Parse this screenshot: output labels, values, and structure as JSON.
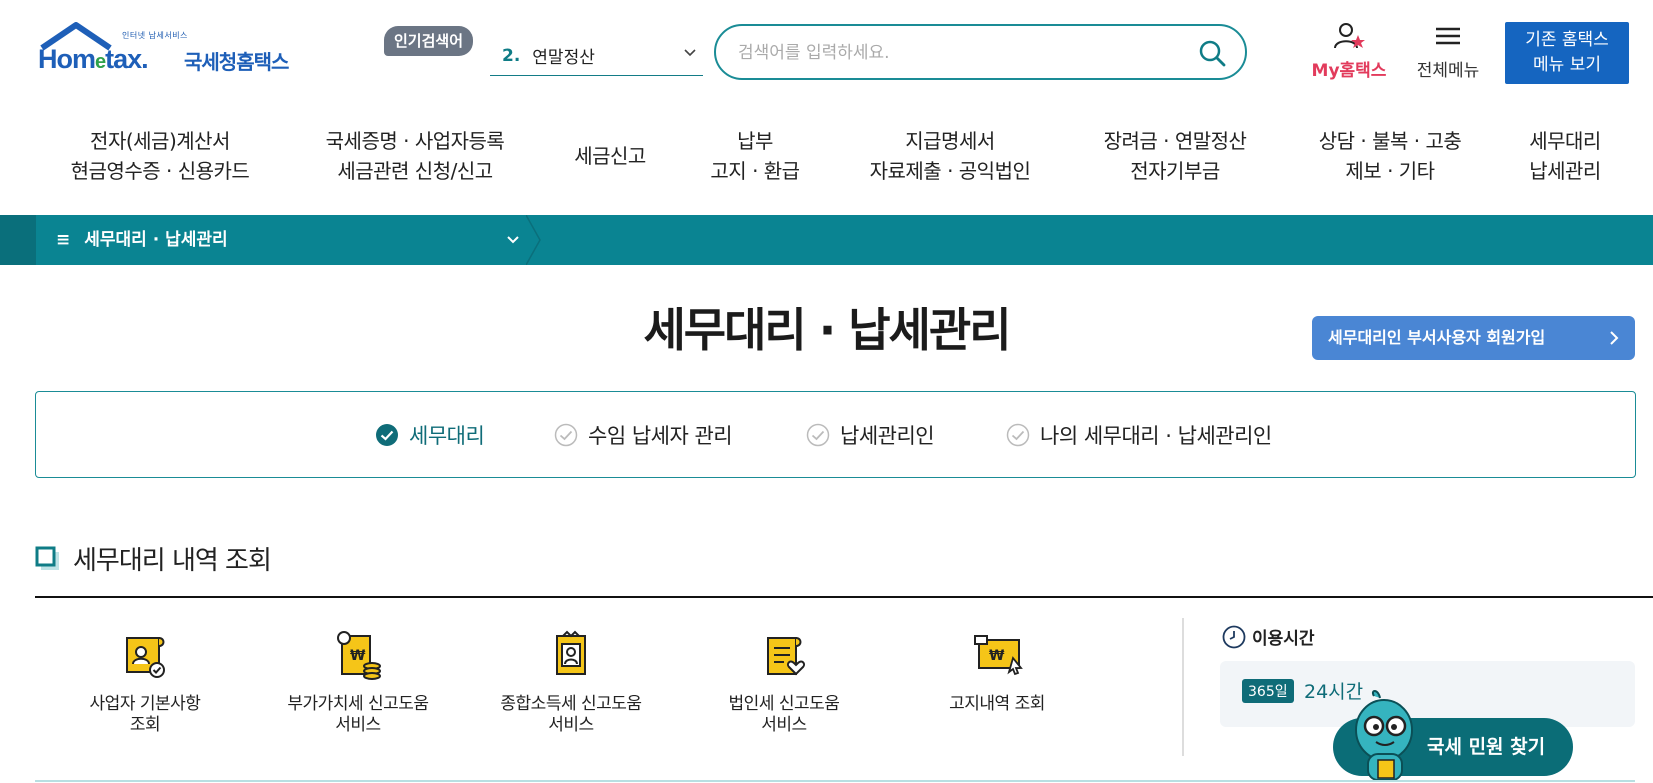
{
  "header": {
    "logo_sub": "인터넷 납세서비스",
    "logo_word_start": "Hom",
    "logo_word_e": "e",
    "logo_word_end": "tax.",
    "logo_korean": "국세청홈택스",
    "popular_badge": "인기검색어",
    "popular_num": "2.",
    "popular_term": "연말정산",
    "search_placeholder": "검색어를 입력하세요.",
    "my_hometax": "My홈택스",
    "all_menu": "전체메뉴",
    "old_hometax_line1": "기존 홈택스",
    "old_hometax_line2": "메뉴 보기"
  },
  "gnb": [
    {
      "line1": "전자(세금)계산서",
      "line2": "현금영수증 · 신용카드"
    },
    {
      "line1": "국세증명 · 사업자등록",
      "line2": "세금관련 신청/신고"
    },
    {
      "line1": "세금신고",
      "line2": ""
    },
    {
      "line1": "납부",
      "line2": "고지 · 환급"
    },
    {
      "line1": "지급명세서",
      "line2": "자료제출 · 공익법인"
    },
    {
      "line1": "장려금 · 연말정산",
      "line2": "전자기부금"
    },
    {
      "line1": "상담 · 불복 · 고충",
      "line2": "제보 · 기타"
    },
    {
      "line1": "세무대리",
      "line2": "납세관리"
    }
  ],
  "location": {
    "current": "세무대리 · 납세관리"
  },
  "page_title": "세무대리 · 납세관리",
  "join_button": "세무대리인 부서사용자 회원가입",
  "tabs": [
    {
      "label": "세무대리",
      "active": true
    },
    {
      "label": "수임 납세자 관리",
      "active": false
    },
    {
      "label": "납세관리인",
      "active": false
    },
    {
      "label": "나의 세무대리 · 납세관리인",
      "active": false
    }
  ],
  "section_title": "세무대리 내역 조회",
  "services": [
    {
      "line1": "사업자 기본사항",
      "line2": "조회",
      "icon": "business-info-icon"
    },
    {
      "line1": "부가가치세 신고도움",
      "line2": "서비스",
      "icon": "vat-help-icon"
    },
    {
      "line1": "종합소득세 신고도움",
      "line2": "서비스",
      "icon": "income-tax-help-icon"
    },
    {
      "line1": "법인세 신고도움",
      "line2": "서비스",
      "icon": "corporate-tax-help-icon"
    },
    {
      "line1": "고지내역 조회",
      "line2": "",
      "icon": "notice-history-icon"
    }
  ],
  "usage": {
    "title": "이용시간",
    "badge": "365일",
    "hours": "24시간"
  },
  "civil_button": "국세 민원 찾기",
  "colors": {
    "teal": "#0a8492",
    "dark_teal": "#0b6d77",
    "blue_button": "#1565c0",
    "join_blue": "#4a86d4",
    "pink": "#e23b5c",
    "icon_yellow": "#f5c518"
  }
}
